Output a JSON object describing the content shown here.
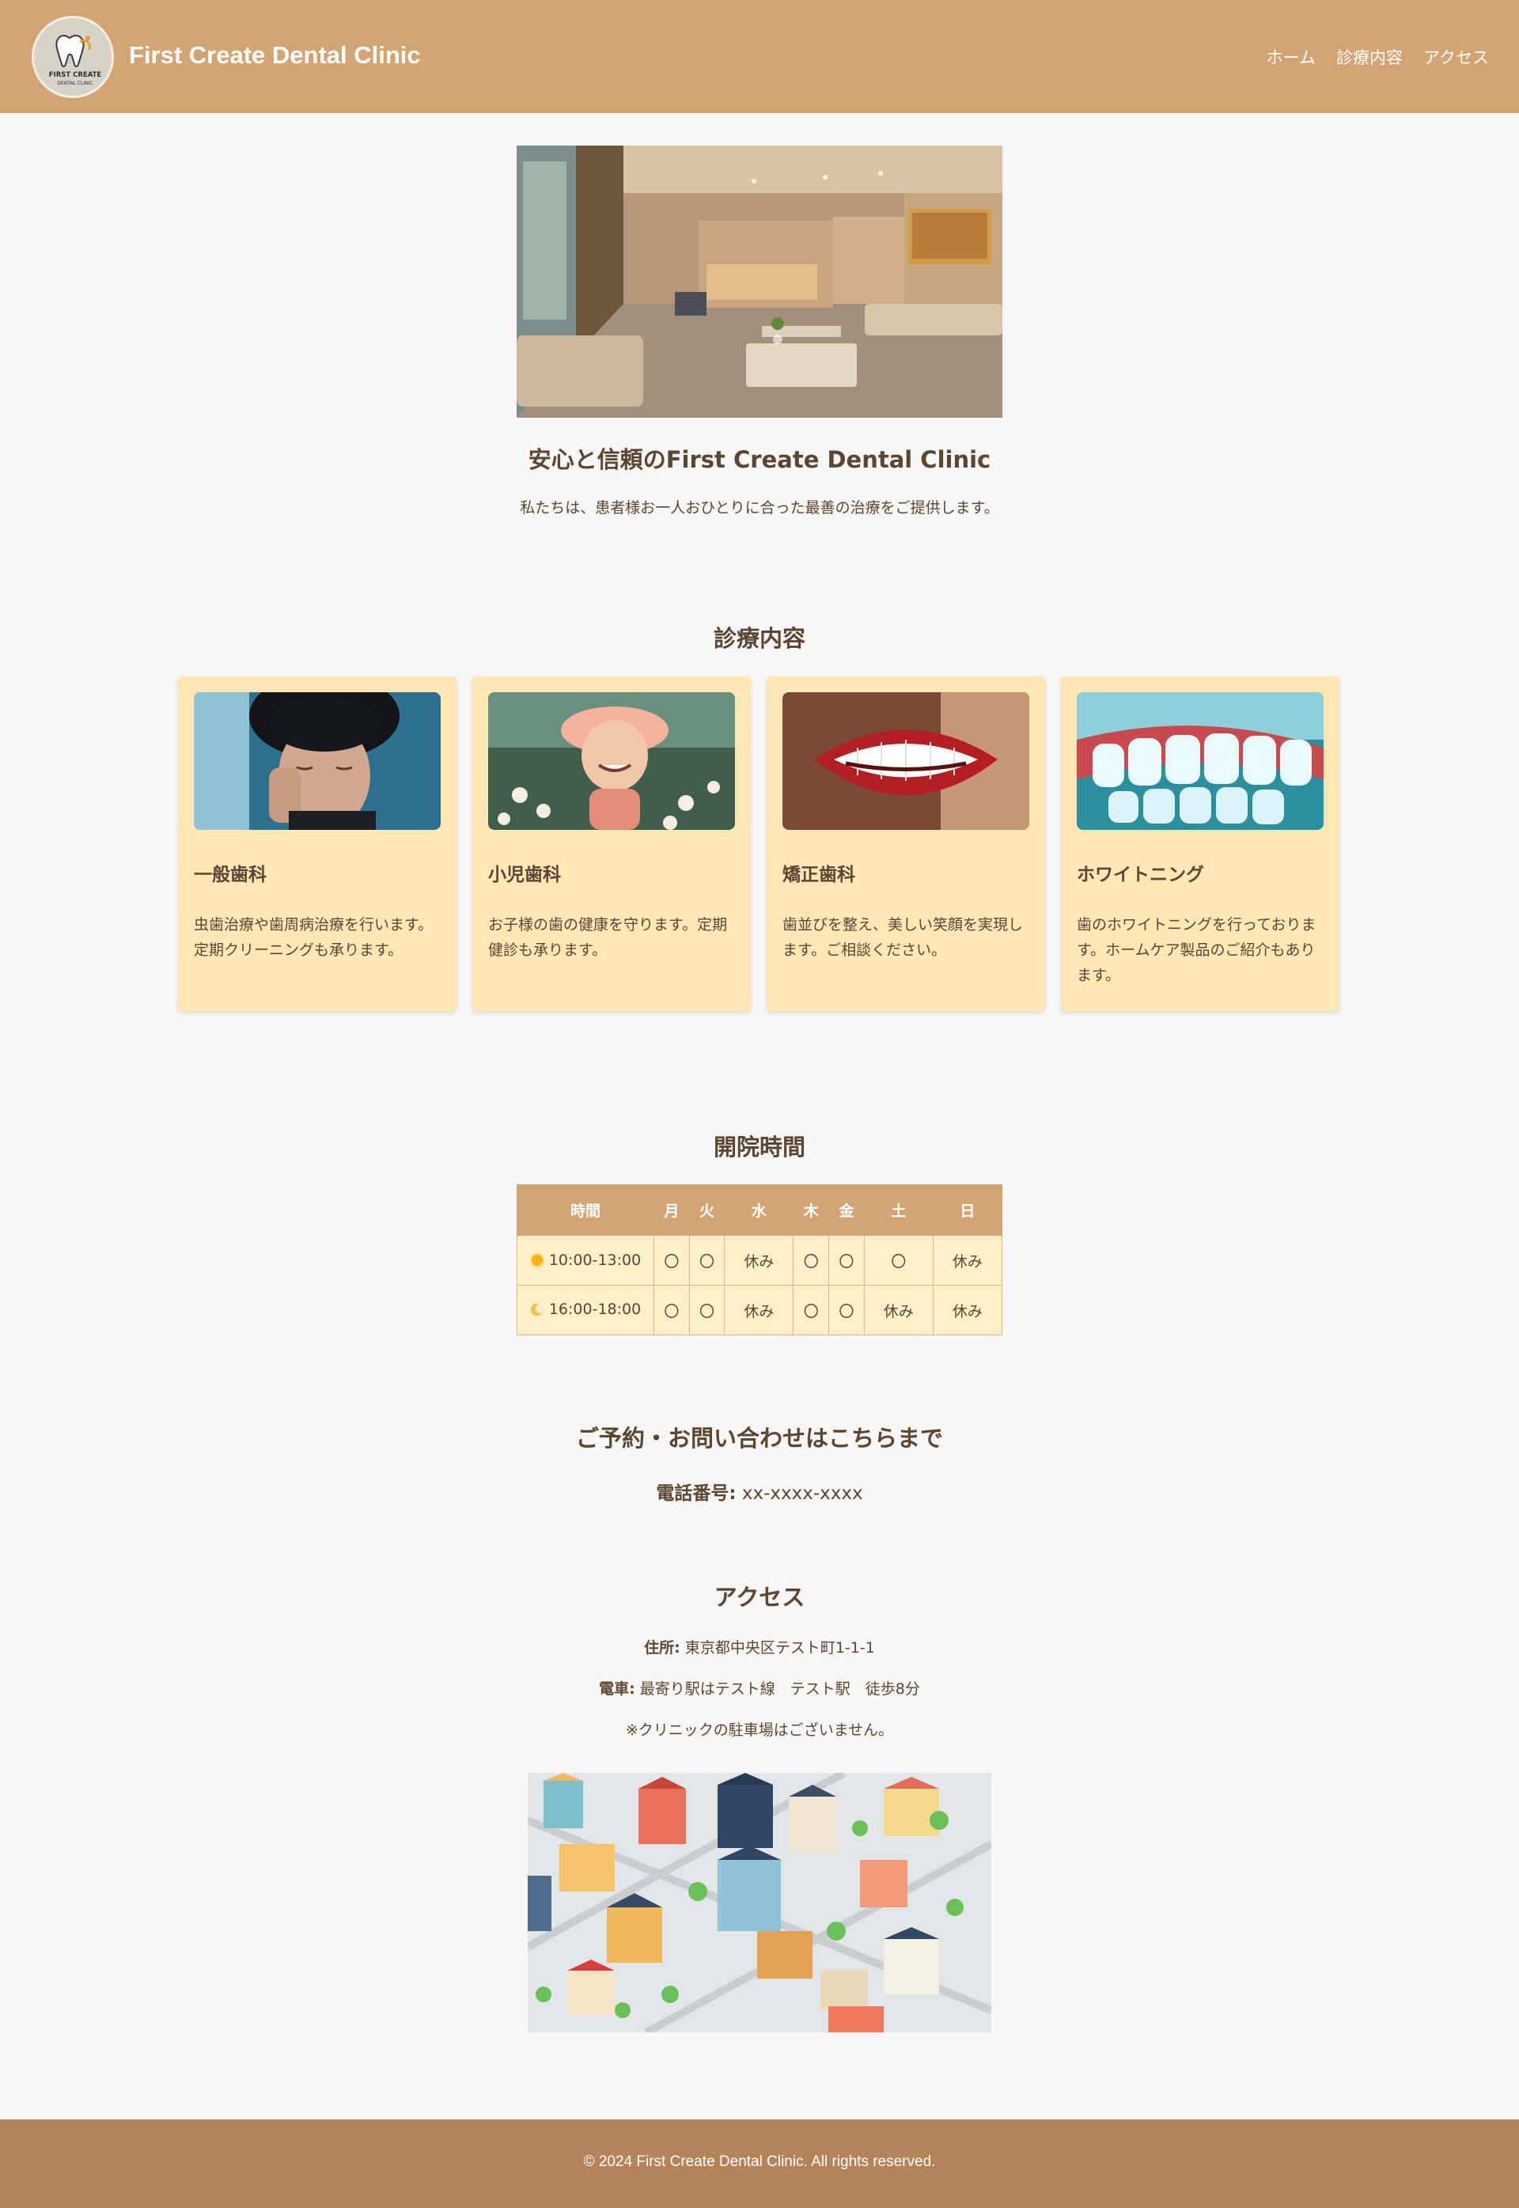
{
  "header": {
    "logo_text_top": "FIRST CREATE",
    "logo_text_bottom": "DENTAL CLINIC",
    "site_title": "First Create Dental Clinic",
    "nav": [
      "ホーム",
      "診療内容",
      "アクセス"
    ]
  },
  "hero": {
    "title": "安心と信頼のFirst Create Dental Clinic",
    "subtitle": "私たちは、患者様お一人おひとりに合った最善の治療をご提供します。"
  },
  "services": {
    "heading": "診療内容",
    "cards": [
      {
        "title": "一般歯科",
        "desc": "虫歯治療や歯周病治療を行います。定期クリーニングも承ります。"
      },
      {
        "title": "小児歯科",
        "desc": "お子様の歯の健康を守ります。定期健診も承ります。"
      },
      {
        "title": "矯正歯科",
        "desc": "歯並びを整え、美しい笑顔を実現します。ご相談ください。"
      },
      {
        "title": "ホワイトニング",
        "desc": "歯のホワイトニングを行っております。ホームケア製品のご紹介もあります。"
      }
    ]
  },
  "hours": {
    "heading": "開院時間",
    "columns": [
      "時間",
      "月",
      "火",
      "水",
      "木",
      "金",
      "土",
      "日"
    ],
    "rows": [
      {
        "icon": "sun-icon",
        "time": "10:00-13:00",
        "days": [
          "〇",
          "〇",
          "休み",
          "〇",
          "〇",
          "〇",
          "休み"
        ]
      },
      {
        "icon": "moon-icon",
        "time": "16:00-18:00",
        "days": [
          "〇",
          "〇",
          "休み",
          "〇",
          "〇",
          "休み",
          "休み"
        ]
      }
    ]
  },
  "contact": {
    "heading": "ご予約・お問い合わせはこちらまで",
    "phone_label": "電話番号:",
    "phone_value": "xx-xxxx-xxxx"
  },
  "access": {
    "heading": "アクセス",
    "address_label": "住所:",
    "address_value": "東京都中央区テスト町1-1-1",
    "train_label": "電車:",
    "train_value": "最寄り駅はテスト線　テスト駅　徒歩8分",
    "note": "※クリニックの駐車場はございません。"
  },
  "footer": {
    "copyright": "© 2024 First Create Dental Clinic. All rights reserved."
  },
  "colors": {
    "header_bg": "#d4a373",
    "card_bg": "#ffe6b5",
    "footer_bg": "#b5835a",
    "text": "#5b4633"
  }
}
